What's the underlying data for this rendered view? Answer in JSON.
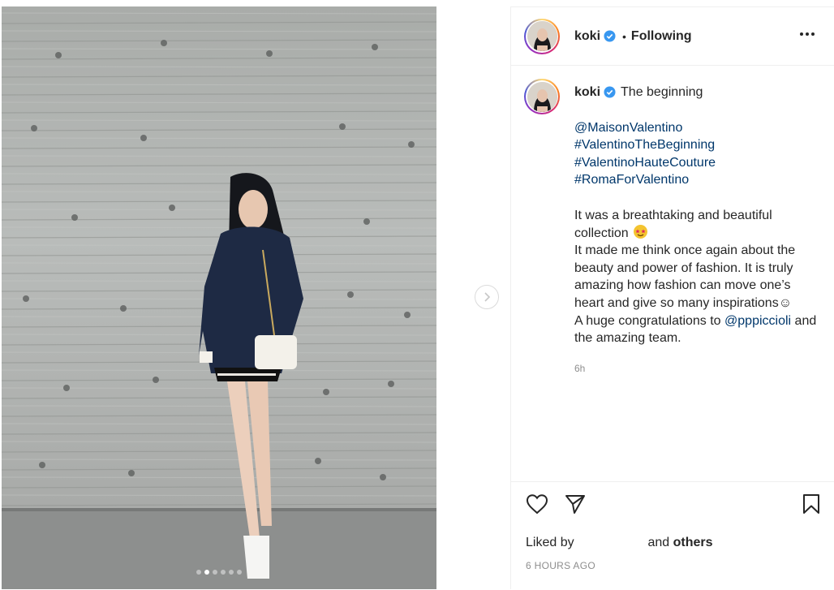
{
  "post": {
    "username": "koki",
    "follow_status": "Following",
    "caption_title": "The beginning",
    "tags": [
      "@MaisonValentino",
      "#ValentinoTheBeginning",
      "#ValentinoHauteCouture",
      "#RomaForValentino"
    ],
    "para1_a": "It was a breathtaking and beautiful collection",
    "para2": "It made me think once again about the beauty and power of fashion. It is truly amazing how fashion can move one’s heart and give so many inspirations",
    "para3_a": "A huge congratulations to",
    "para3_mention": "@pppiccioli",
    "para3_b": "and the amazing team.",
    "time_short": "6h",
    "liked_by_label": "Liked by",
    "and_label": "and",
    "others_label": "others",
    "time_long": "6 HOURS AGO",
    "carousel": {
      "total": 6,
      "active": 2
    }
  },
  "icons": {
    "verified": "verified-badge-icon",
    "more": "more-options-icon",
    "like": "heart-icon",
    "share": "share-icon",
    "save": "bookmark-icon",
    "next": "chevron-right-icon"
  },
  "colors": {
    "link": "#00376b",
    "verified": "#3897f0",
    "muted": "#8e8e8e"
  }
}
